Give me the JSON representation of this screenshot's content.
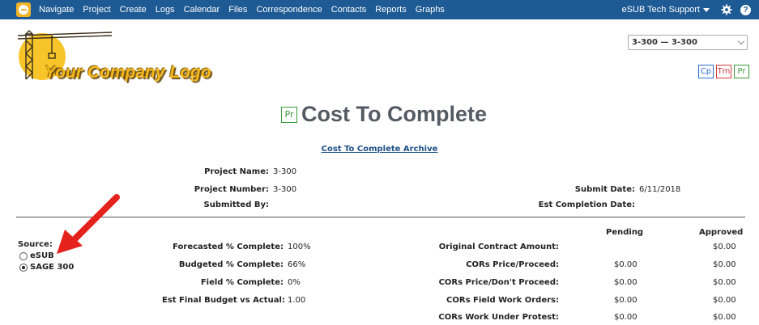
{
  "nav": {
    "items": [
      "Navigate",
      "Project",
      "Create",
      "Logs",
      "Calendar",
      "Files",
      "Correspondence",
      "Contacts",
      "Reports",
      "Graphs"
    ],
    "user": "eSUB Tech Support",
    "brand_color": "#1e5a93"
  },
  "logo": {
    "text": "Your Company Logo"
  },
  "project_select": {
    "value": "3-300 — 3-300"
  },
  "badges": {
    "cp": "Cp",
    "tm": "Tm",
    "pr": "Pr"
  },
  "title": {
    "badge": "Pr",
    "text": "Cost To Complete"
  },
  "archive_link": "Cost To Complete Archive",
  "info": {
    "project_name_label": "Project Name:",
    "project_name": "3-300",
    "project_number_label": "Project Number:",
    "project_number": "3-300",
    "submitted_by_label": "Submitted By:",
    "submitted_by": "",
    "submit_date_label": "Submit Date:",
    "submit_date": "6/11/2018",
    "est_completion_label": "Est Completion Date:",
    "est_completion": ""
  },
  "source": {
    "label": "Source:",
    "options": [
      {
        "label": "eSUB",
        "checked": false
      },
      {
        "label": "SAGE 300",
        "checked": true
      }
    ]
  },
  "left_stats": [
    {
      "label": "Forecasted % Complete:",
      "value": "100%"
    },
    {
      "label": "Budgeted % Complete:",
      "value": "66%"
    },
    {
      "label": "Field % Complete:",
      "value": "0%"
    },
    {
      "label": "Est Final Budget vs Actual:",
      "value": "1.00"
    }
  ],
  "right_stats": {
    "headers": {
      "pending": "Pending",
      "approved": "Approved"
    },
    "rows": [
      {
        "label": "Original Contract Amount:",
        "pending": "",
        "approved": "$0.00"
      },
      {
        "label": "CORs Price/Proceed:",
        "pending": "$0.00",
        "approved": "$0.00"
      },
      {
        "label": "CORs Price/Don't Proceed:",
        "pending": "$0.00",
        "approved": "$0.00"
      },
      {
        "label": "CORs Field Work Orders:",
        "pending": "$0.00",
        "approved": "$0.00"
      },
      {
        "label": "CORs Work Under Protest:",
        "pending": "$0.00",
        "approved": "$0.00"
      }
    ]
  }
}
